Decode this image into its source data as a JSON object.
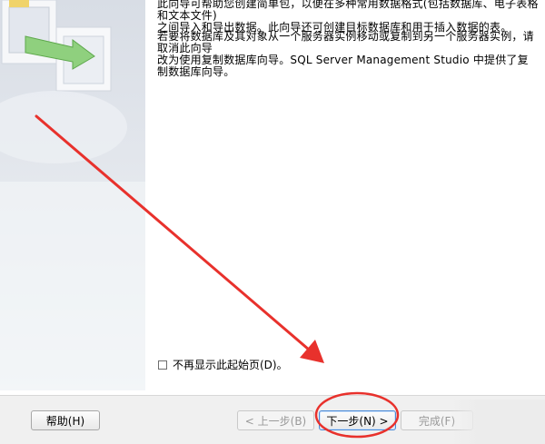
{
  "content": {
    "paragraph1": "此向导可帮助您创建简单包，以便在多种常用数据格式(包括数据库、电子表格和文本文件)\n之间导入和导出数据。此向导还可创建目标数据库和用于插入数据的表。",
    "paragraph2": "若要将数据库及其对象从一个服务器实例移动或复制到另一个服务器实例，请取消此向导\n改为使用复制数据库向导。SQL Server Management Studio 中提供了复制数据库向导。"
  },
  "checkbox": {
    "label": "不再显示此起始页(D)。",
    "checked": false
  },
  "buttons": {
    "help": "帮助(H)",
    "back": "< 上一步(B)",
    "next": "下一步(N) >",
    "finish": "完成(F)"
  },
  "colors": {
    "annotation_red": "#e8312c",
    "focus_blue": "#4a8ad6"
  },
  "icons": {
    "side_art": "import-export-graphic"
  }
}
